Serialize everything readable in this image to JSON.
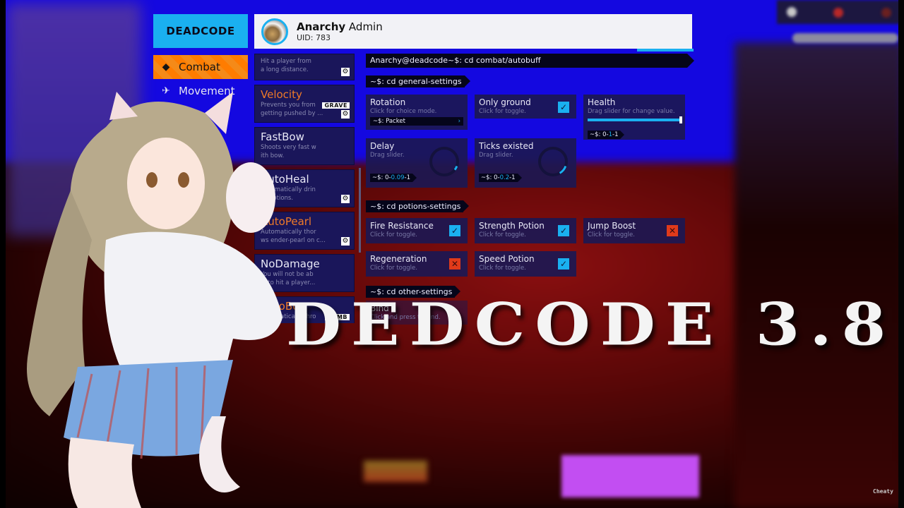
{
  "gui": {
    "logo": "DEADCODE",
    "profile": {
      "name_bold": "Anarchy",
      "name_rest": " Admin",
      "uid": "UID: 783"
    },
    "categories": [
      {
        "label": "Combat",
        "icon": "combat-icon",
        "glyph": "◆",
        "active": true
      },
      {
        "label": "Movement",
        "icon": "plane-icon",
        "glyph": "✈",
        "active": false
      }
    ],
    "modules": [
      {
        "title": "",
        "desc": [
          "Hit a player from",
          "a long distance."
        ],
        "accent": false,
        "gear": true,
        "bind": ""
      },
      {
        "title": "Velocity",
        "desc": [
          "Prevents you from",
          "getting pushed by ..."
        ],
        "accent": true,
        "gear": true,
        "bind": "GRAVE"
      },
      {
        "title": "FastBow",
        "desc": [
          "Shoots very fast w",
          "ith bow."
        ],
        "accent": false,
        "gear": false,
        "bind": ""
      },
      {
        "title": "AutoHeal",
        "desc": [
          "Automatically drin",
          "ks potions."
        ],
        "accent": false,
        "gear": true,
        "bind": ""
      },
      {
        "title": "AutoPearl",
        "desc": [
          "Automatically thor",
          "ws ender-pearl on c..."
        ],
        "accent": true,
        "gear": true,
        "bind": ""
      },
      {
        "title": "NoDamage",
        "desc": [
          "You will not be ab",
          "le to hit a player..."
        ],
        "accent": false,
        "gear": false,
        "bind": ""
      },
      {
        "title": "AutoBow",
        "desc": [
          "Automatically thro",
          ""
        ],
        "accent": true,
        "gear": false,
        "bind": "NUMB"
      }
    ],
    "path": "Anarchy@deadcode~$: cd combat/autobuff",
    "sections": {
      "general": "~$: cd general-settings",
      "potions": "~$: cd potions-settings",
      "other": "~$: cd other-settings"
    },
    "general": {
      "rotation": {
        "name": "Rotation",
        "hint": "Click for choice mode.",
        "value": "~$: Packet",
        "arrow": "›"
      },
      "only_ground": {
        "name": "Only ground",
        "hint": "Click for toggle.",
        "checked": true,
        "mark": "✓"
      },
      "health": {
        "name": "Health",
        "hint": "Drag slider for change value.",
        "prefix": "~$: 0-",
        "current": "1",
        "suffix": "-1",
        "fraction": 1.0
      },
      "delay": {
        "name": "Delay",
        "hint": "Drag slider.",
        "prefix": "~$: 0-",
        "current": "0.09",
        "suffix": "-1",
        "fraction": 0.09
      },
      "ticks": {
        "name": "Ticks existed",
        "hint": "Drag slider.",
        "prefix": "~$: 0-",
        "current": "0.2",
        "suffix": "-1",
        "fraction": 0.2
      }
    },
    "potions": [
      {
        "name": "Fire Resistance",
        "hint": "Click for toggle.",
        "checked": true,
        "mark": "✓"
      },
      {
        "name": "Strength Potion",
        "hint": "Click for toggle.",
        "checked": true,
        "mark": "✓"
      },
      {
        "name": "Jump Boost",
        "hint": "Click for toggle.",
        "checked": false,
        "mark": "✕"
      },
      {
        "name": "Regeneration",
        "hint": "Click for toggle.",
        "checked": false,
        "mark": "✕"
      },
      {
        "name": "Speed Potion",
        "hint": "Click for toggle.",
        "checked": true,
        "mark": "✓"
      }
    ],
    "other": {
      "bind": {
        "name": "Bind",
        "hint": "Click and press to bind."
      }
    }
  },
  "overlay": {
    "title": "DEDCODE 3.8",
    "watermark": "Cheaty"
  },
  "colors": {
    "accent_blue": "#1ab0f0",
    "accent_orange": "#ff7c00",
    "toggle_off": "#e03a1a",
    "panel": "#1c1852"
  }
}
